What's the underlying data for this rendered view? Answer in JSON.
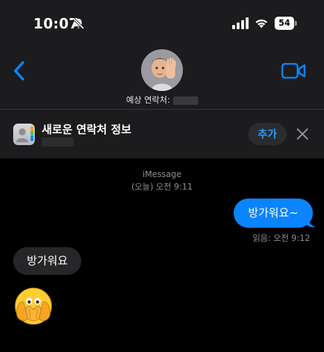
{
  "status_bar": {
    "time": "10:07",
    "battery": "54"
  },
  "header": {
    "contact_caption": "예상 연락처:"
  },
  "banner": {
    "title": "새로운 연락처 정보",
    "add_label": "추가"
  },
  "conversation": {
    "service": "iMessage",
    "timestamp": "(오늘) 오전 9:11",
    "messages": [
      {
        "direction": "sent",
        "text": "방가워요~"
      },
      {
        "direction": "received",
        "text": "방가워요"
      }
    ],
    "read_receipt": "읽음: 오전 9:12"
  },
  "icons": {
    "bell": "bell-slash-icon",
    "signal": "cellular-signal-icon",
    "wifi": "wifi-icon",
    "back": "chevron-left-icon",
    "video": "video-camera-icon",
    "close": "close-icon",
    "emoji": "face-with-open-eyes-and-hand-over-mouth-emoji"
  },
  "colors": {
    "accent": "#0a84ff",
    "sent_bubble": "#0a84ff",
    "received_bubble": "#262628",
    "header_bg": "#1c1c1e"
  }
}
